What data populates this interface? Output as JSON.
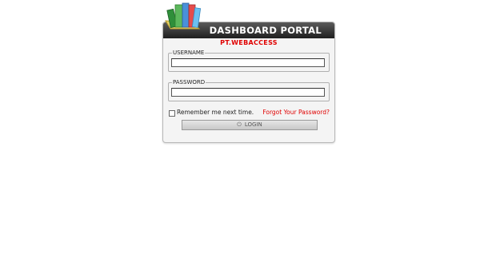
{
  "header": {
    "title": "DASHBOARD PORTAL",
    "subtitle": "PT.WEBACCESS"
  },
  "form": {
    "username_label": "USERNAME",
    "username_value": "",
    "password_label": "PASSWORD",
    "password_value": "",
    "remember_label": "Remember me next time.",
    "forgot_label": "Forgot Your Password?",
    "login_label": "LOGIN"
  },
  "icons": {
    "logo": "books-icon",
    "login": "power-icon",
    "checkbox": "checkbox-icon"
  },
  "colors": {
    "header_bg": "#1f1f1f",
    "accent_red": "#e00000",
    "panel_bg": "#f4f4f4"
  }
}
